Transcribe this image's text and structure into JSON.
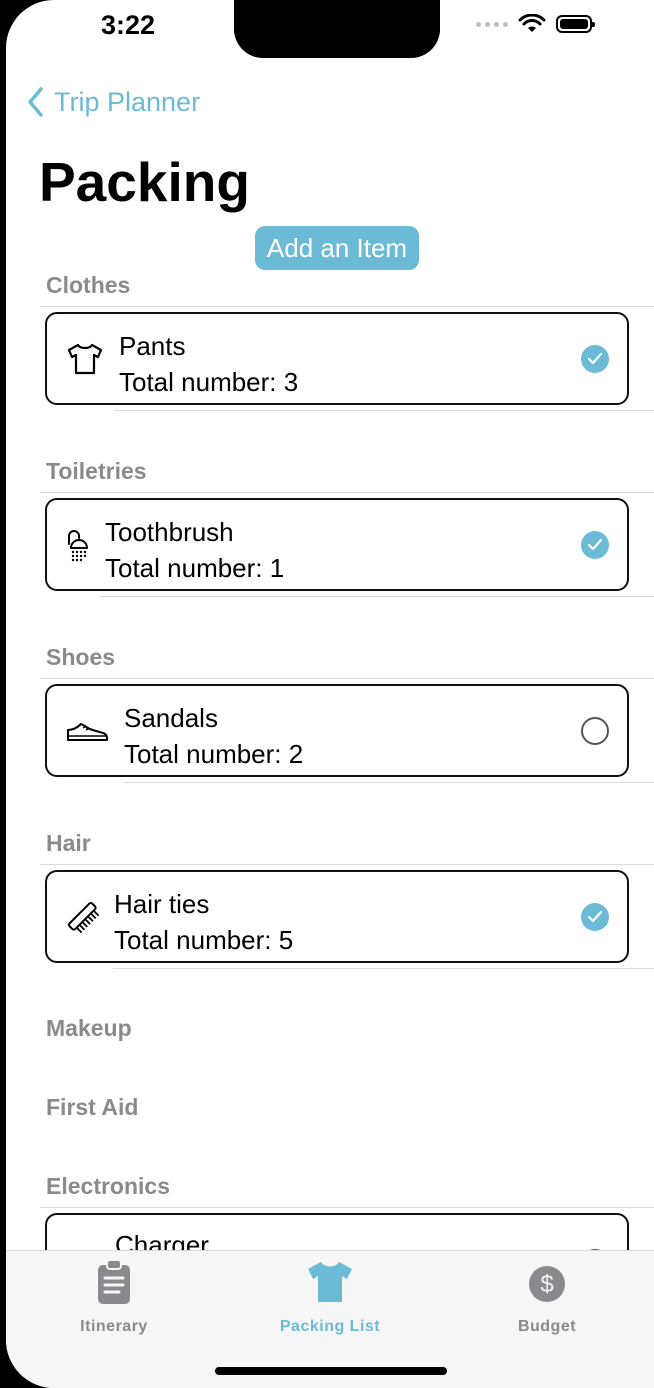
{
  "status_bar": {
    "time": "3:22"
  },
  "nav": {
    "back_label": "Trip Planner",
    "title": "Packing",
    "add_button": "Add an Item"
  },
  "sections": [
    {
      "header": "Clothes",
      "items": [
        {
          "name": "Pants",
          "count": "Total number: 3",
          "icon": "tshirt-icon",
          "checked": true
        }
      ]
    },
    {
      "header": "Toiletries",
      "items": [
        {
          "name": "Toothbrush",
          "count": "Total number: 1",
          "icon": "shower-icon",
          "checked": true
        }
      ]
    },
    {
      "header": "Shoes",
      "items": [
        {
          "name": "Sandals",
          "count": "Total number: 2",
          "icon": "shoe-icon",
          "checked": false
        }
      ]
    },
    {
      "header": "Hair",
      "items": [
        {
          "name": "Hair ties",
          "count": "Total number: 5",
          "icon": "comb-icon",
          "checked": true
        }
      ]
    },
    {
      "header": "Makeup",
      "items": []
    },
    {
      "header": "First Aid",
      "items": []
    },
    {
      "header": "Electronics",
      "items": [
        {
          "name": "Charger",
          "icon": "charger-icon",
          "checked": false
        }
      ]
    }
  ],
  "tabs": [
    {
      "label": "Itinerary",
      "icon": "clipboard-icon",
      "active": false
    },
    {
      "label": "Packing List",
      "icon": "tshirt-icon",
      "active": true
    },
    {
      "label": "Budget",
      "icon": "dollar-circle-icon",
      "active": false
    }
  ],
  "colors": {
    "accent": "#6bbbd6",
    "section_header": "#8a8a8e",
    "background": "#ffffff"
  }
}
